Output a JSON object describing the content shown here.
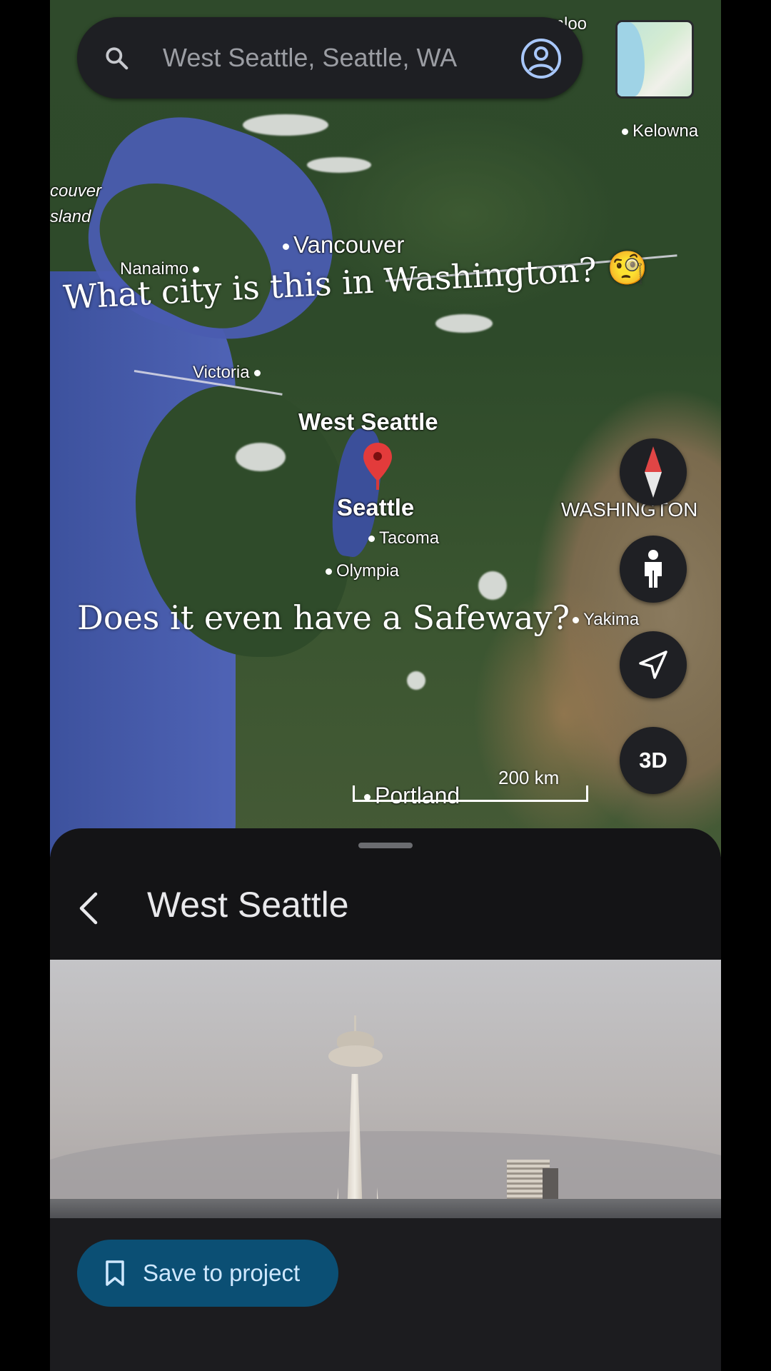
{
  "search": {
    "placeholder": "West Seattle, Seattle, WA"
  },
  "map": {
    "labels": {
      "kamloops_partial": "mloo",
      "kelowna": "Kelowna",
      "vancouver_island_1": "couver",
      "vancouver_island_2": "sland",
      "vancouver": "Vancouver",
      "nanaimo": "Nanaimo",
      "victoria": "Victoria",
      "west_seattle": "West Seattle",
      "seattle": "Seattle",
      "tacoma": "Tacoma",
      "olympia": "Olympia",
      "washington": "WASHINGTON",
      "yakima": "Yakima",
      "portland": "Portland"
    },
    "scale_label": "200 km",
    "three_d_label": "3D"
  },
  "overlay": {
    "caption_1": "What city is this in Washington? 🧐",
    "caption_2": "Does it even have a Safeway?"
  },
  "sheet": {
    "title": "West Seattle",
    "save_label": "Save to project"
  },
  "colors": {
    "save_button": "#0b4f74",
    "pin": "#e33b3b",
    "sheet_bg": "#141416"
  },
  "icons": [
    "search-icon",
    "account-icon",
    "compass-icon",
    "street-view-icon",
    "location-arrow-icon",
    "back-arrow-icon",
    "bookmark-icon",
    "map-pin-icon"
  ]
}
